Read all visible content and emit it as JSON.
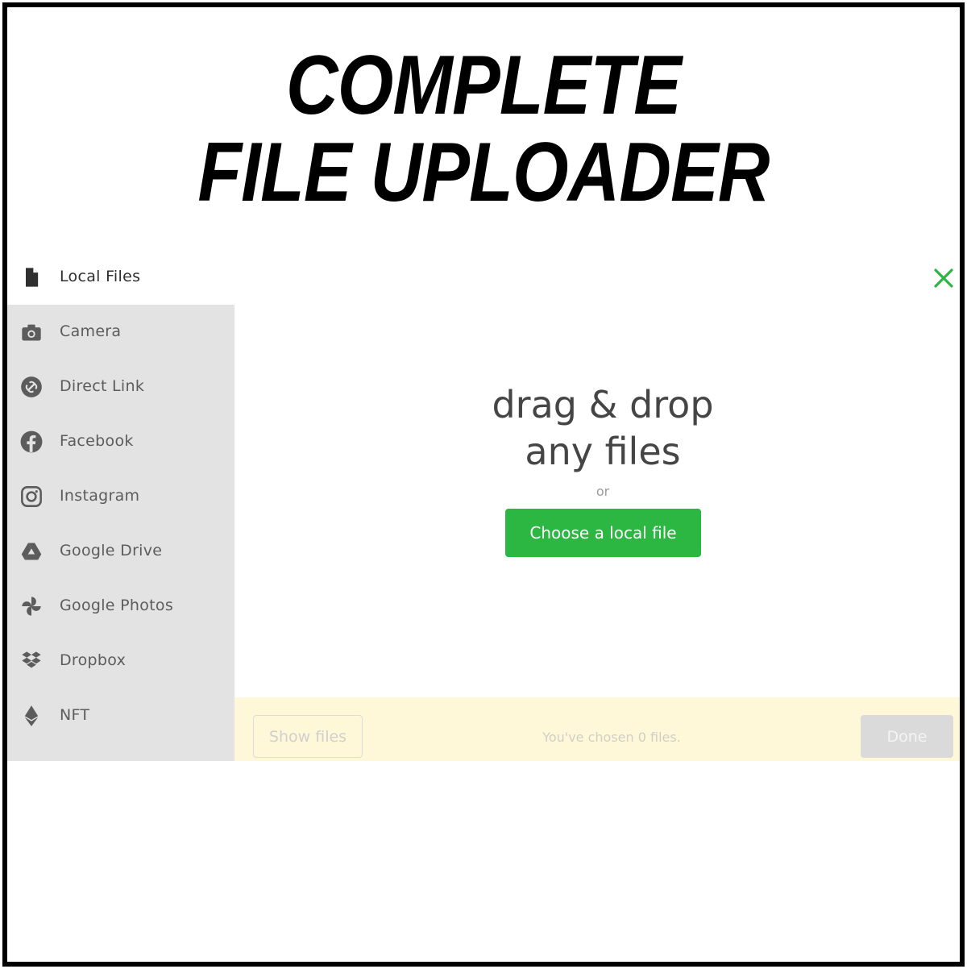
{
  "headline": {
    "line1": "COMPLETE",
    "line2": "FILE UPLOADER"
  },
  "sidebar": {
    "items": [
      {
        "label": "Local Files",
        "icon": "file-icon",
        "active": true
      },
      {
        "label": "Camera",
        "icon": "camera-icon"
      },
      {
        "label": "Direct Link",
        "icon": "link-icon"
      },
      {
        "label": "Facebook",
        "icon": "facebook-icon"
      },
      {
        "label": "Instagram",
        "icon": "instagram-icon"
      },
      {
        "label": "Google Drive",
        "icon": "google-drive-icon"
      },
      {
        "label": "Google Photos",
        "icon": "google-photos-icon"
      },
      {
        "label": "Dropbox",
        "icon": "dropbox-icon"
      },
      {
        "label": "NFT",
        "icon": "ethereum-icon"
      }
    ]
  },
  "dropzone": {
    "title_line1": "drag & drop",
    "title_line2": "any files",
    "or": "or",
    "choose_label": "Choose a local file"
  },
  "footer": {
    "show_files_label": "Show files",
    "chosen_text": "You've chosen 0 files.",
    "done_label": "Done"
  },
  "colors": {
    "accent": "#2cb742",
    "sidebar_bg": "#e4e3e4",
    "footer_bg": "#fff8d8",
    "icon": "#5c5c5c"
  },
  "icons": {
    "close": "close-icon"
  }
}
